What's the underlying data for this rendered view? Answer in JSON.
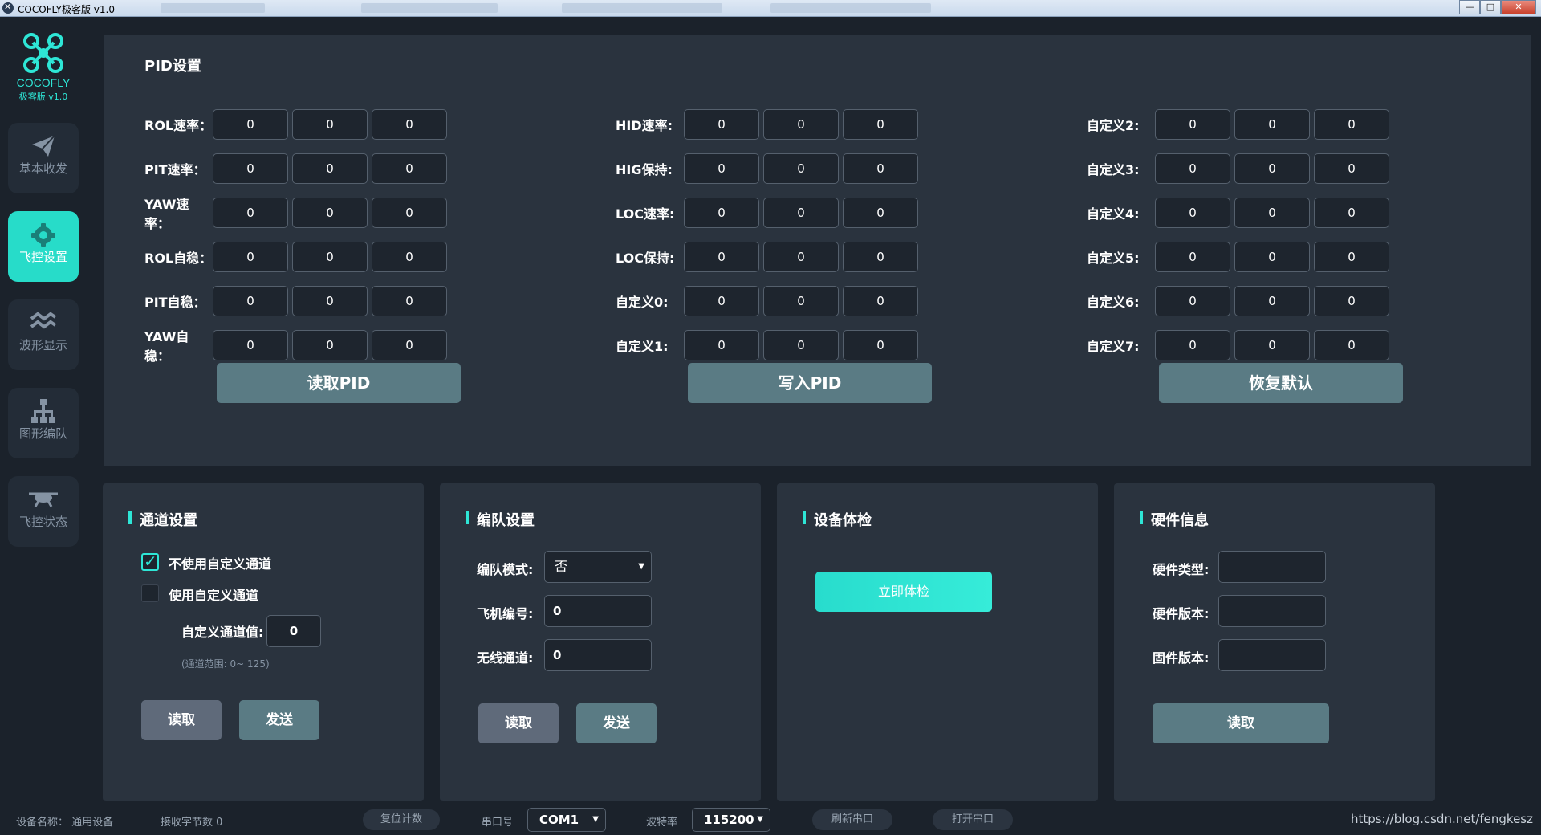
{
  "window": {
    "title": "COCOFLY极客版 v1.0",
    "minimize": "—",
    "maximize": "□",
    "close": "✕"
  },
  "brand": {
    "name": "COCOFLY",
    "version": "极客版 v1.0"
  },
  "sidebar": {
    "items": [
      {
        "label": "基本收发",
        "icon": "paper-plane-icon"
      },
      {
        "label": "飞控设置",
        "icon": "gear-icon",
        "active": true
      },
      {
        "label": "波形显示",
        "icon": "wave-icon"
      },
      {
        "label": "图形编队",
        "icon": "hierarchy-icon"
      },
      {
        "label": "飞控状态",
        "icon": "drone-icon"
      }
    ]
  },
  "pid": {
    "title": "PID设置",
    "col1": [
      {
        "label": "ROL速率：",
        "values": [
          "0",
          "0",
          "0"
        ]
      },
      {
        "label": "PIT速率：",
        "values": [
          "0",
          "0",
          "0"
        ]
      },
      {
        "label": "YAW速率：",
        "values": [
          "0",
          "0",
          "0"
        ]
      },
      {
        "label": "ROL自稳：",
        "values": [
          "0",
          "0",
          "0"
        ]
      },
      {
        "label": "PIT自稳：",
        "values": [
          "0",
          "0",
          "0"
        ]
      },
      {
        "label": "YAW自稳：",
        "values": [
          "0",
          "0",
          "0"
        ]
      }
    ],
    "col2": [
      {
        "label": "HID速率:",
        "values": [
          "0",
          "0",
          "0"
        ]
      },
      {
        "label": "HIG保持:",
        "values": [
          "0",
          "0",
          "0"
        ]
      },
      {
        "label": "LOC速率:",
        "values": [
          "0",
          "0",
          "0"
        ]
      },
      {
        "label": "LOC保持:",
        "values": [
          "0",
          "0",
          "0"
        ]
      },
      {
        "label": "自定义0:",
        "values": [
          "0",
          "0",
          "0"
        ]
      },
      {
        "label": "自定义1:",
        "values": [
          "0",
          "0",
          "0"
        ]
      }
    ],
    "col3": [
      {
        "label": "自定义2:",
        "values": [
          "0",
          "0",
          "0"
        ]
      },
      {
        "label": "自定义3:",
        "values": [
          "0",
          "0",
          "0"
        ]
      },
      {
        "label": "自定义4:",
        "values": [
          "0",
          "0",
          "0"
        ]
      },
      {
        "label": "自定义5:",
        "values": [
          "0",
          "0",
          "0"
        ]
      },
      {
        "label": "自定义6:",
        "values": [
          "0",
          "0",
          "0"
        ]
      },
      {
        "label": "自定义7:",
        "values": [
          "0",
          "0",
          "0"
        ]
      }
    ],
    "read_btn": "读取PID",
    "write_btn": "写入PID",
    "reset_btn": "恢复默认"
  },
  "channel": {
    "title": "通道设置",
    "opt_default": "不使用自定义通道",
    "opt_custom": "使用自定义通道",
    "custom_label": "自定义通道值:",
    "custom_value": "0",
    "range_hint": "(通道范围: 0~ 125)",
    "read_btn": "读取",
    "send_btn": "发送"
  },
  "formation": {
    "title": "编队设置",
    "mode_label": "编队模式:",
    "mode_value": "否",
    "plane_label": "飞机编号:",
    "plane_value": "0",
    "wireless_label": "无线通道:",
    "wireless_value": "0",
    "read_btn": "读取",
    "send_btn": "发送"
  },
  "check": {
    "title": "设备体检",
    "btn": "立即体检"
  },
  "hardware": {
    "title": "硬件信息",
    "type_label": "硬件类型:",
    "hw_ver_label": "硬件版本:",
    "fw_ver_label": "固件版本:",
    "type_value": "",
    "hw_ver_value": "",
    "fw_ver_value": "",
    "read_btn": "读取"
  },
  "status": {
    "device_name": "设备名称：  通用设备",
    "rx_bytes": "接收字节数 0",
    "reset_count": "复位计数",
    "port_label": "串口号",
    "port_value": "COM1",
    "baud_label": "波特率",
    "baud_value": "115200",
    "refresh_port": "刷新串口",
    "open_port": "打开串口",
    "url": "https://blog.csdn.net/fengkesz"
  }
}
